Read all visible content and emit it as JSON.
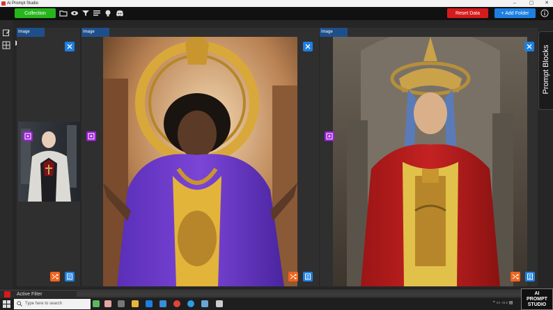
{
  "window": {
    "title": "Ai Prompt Studio",
    "minimize": "–",
    "maximize": "▢",
    "close": "✕"
  },
  "toolbar": {
    "collection_label": "Collection",
    "reset_label": "Reset Data",
    "add_folder_label": "+ Add Folder",
    "accent_green": "#27b51c",
    "accent_red": "#d51b1b",
    "accent_blue": "#1d7fe0",
    "icons": [
      "folder-icon",
      "eye-icon",
      "filter-icon",
      "list-icon",
      "lightbulb-icon",
      "discord-icon",
      "info-icon"
    ]
  },
  "sidebar": {
    "icons": [
      "edit-icon",
      "grid-icon"
    ]
  },
  "panels": [
    {
      "header": "Image",
      "subject": "pale man in a white hooded cloak with a red collar"
    },
    {
      "header": "Image",
      "subject": "woman in a gold halo crown and purple robe"
    },
    {
      "header": "Image",
      "subject": "woman with blue hair in a gold crown and red cape"
    }
  ],
  "prompt_tab": {
    "label": "Prompt Blocks"
  },
  "filter": {
    "label": "Active Filter"
  },
  "taskbar": {
    "search_placeholder": "Type here to search"
  },
  "logo": {
    "line1": "AI",
    "line2": "PROMPT",
    "line3": "STUDIO"
  }
}
